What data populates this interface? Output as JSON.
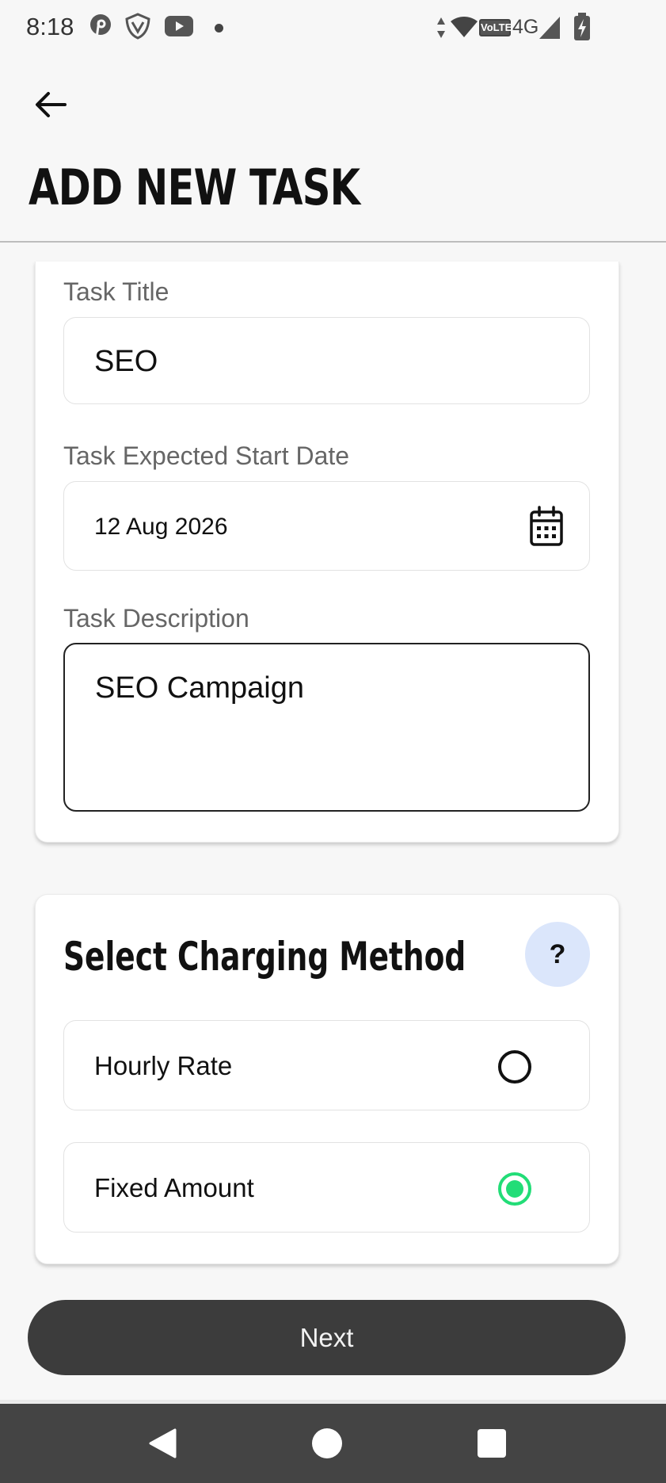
{
  "status_bar": {
    "time": "8:18",
    "volte": "VoLTE",
    "network": "4G",
    "icons": [
      "pinterest-icon",
      "shield-icon",
      "youtube-icon",
      "notification-dot",
      "data-arrows-icon",
      "wifi-icon",
      "volte-icon",
      "signal-icon",
      "battery-charging-icon"
    ]
  },
  "header": {
    "back_icon": "back-arrow-icon",
    "title": "ADD NEW TASK"
  },
  "form": {
    "task_title": {
      "label": "Task Title",
      "value": "SEO"
    },
    "start_date": {
      "label": "Task Expected Start Date",
      "value": "12 Aug 2026",
      "icon": "calendar-icon"
    },
    "description": {
      "label": "Task Description",
      "value": "SEO Campaign"
    }
  },
  "charging": {
    "title": "Select Charging Method",
    "help_label": "?",
    "options": [
      {
        "label": "Hourly Rate",
        "selected": false
      },
      {
        "label": "Fixed Amount",
        "selected": true
      }
    ],
    "selected_color": "#22dd77"
  },
  "next_button": {
    "label": "Next"
  },
  "nav_bar": {
    "icons": [
      "back-triangle-icon",
      "home-circle-icon",
      "recents-square-icon"
    ]
  },
  "colors": {
    "background": "#f7f7f7",
    "card": "#ffffff",
    "button": "#3c3c3c",
    "help_bg": "#dbe6fb",
    "nav_bar": "#444444"
  }
}
